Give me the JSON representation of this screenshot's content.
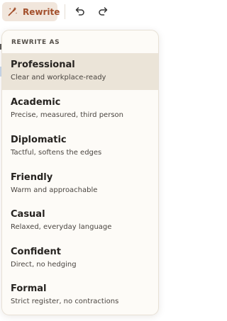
{
  "toolbar": {
    "rewrite_label": "Rewrite",
    "accent": "#a3502c",
    "rewrite_bg": "#f1e6dc",
    "icons": [
      "magic-wand-icon",
      "undo-icon",
      "redo-icon"
    ]
  },
  "dropdown": {
    "header": "REWRITE AS",
    "selected_index": 0,
    "options": [
      {
        "title": "Professional",
        "description": "Clear and workplace-ready"
      },
      {
        "title": "Academic",
        "description": "Precise, measured, third person"
      },
      {
        "title": "Diplomatic",
        "description": "Tactful, softens the edges"
      },
      {
        "title": "Friendly",
        "description": "Warm and approachable"
      },
      {
        "title": "Casual",
        "description": "Relaxed, everyday language"
      },
      {
        "title": "Confident",
        "description": "Direct, no hedging"
      },
      {
        "title": "Formal",
        "description": "Strict register, no contractions"
      }
    ]
  }
}
